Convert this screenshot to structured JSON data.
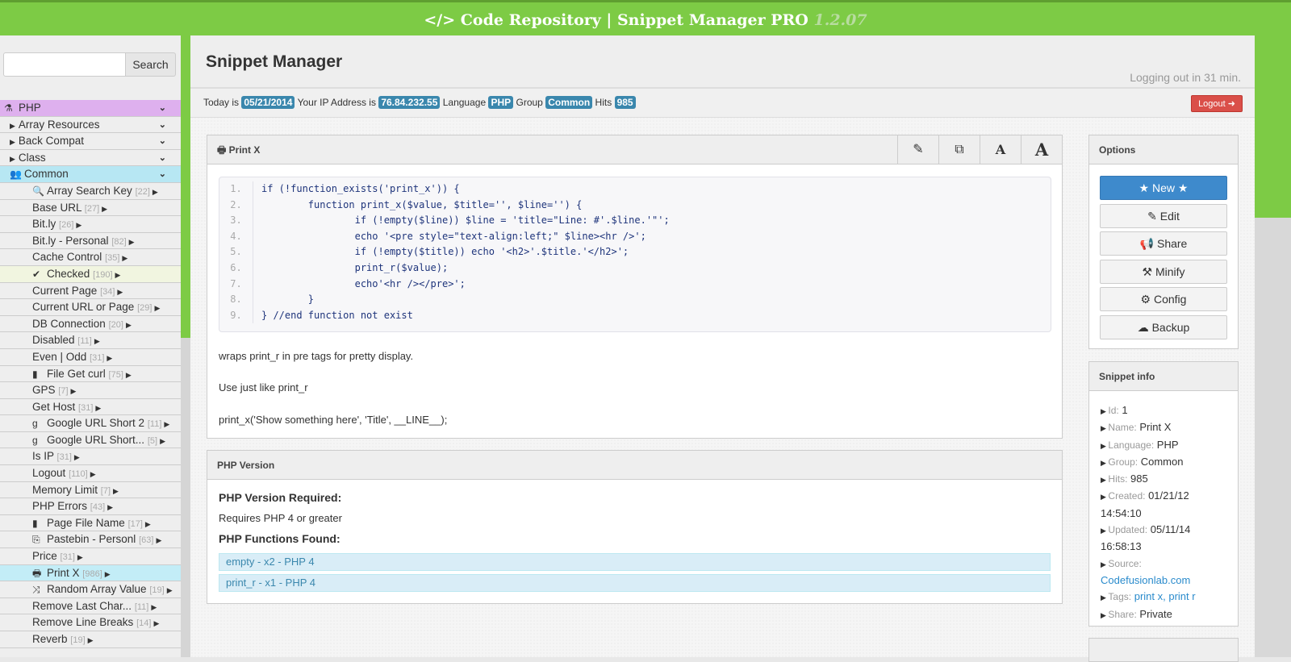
{
  "header": {
    "icon": "code-icon",
    "title": "Code Repository | Snippet Manager PRO",
    "version": "1.2.07"
  },
  "search": {
    "placeholder": "",
    "button": "Search"
  },
  "nav": [
    {
      "label": "PHP",
      "lvl": "lvl0",
      "icon": "⚗",
      "chev": true
    },
    {
      "label": "Array Resources",
      "lvl": "lvl1",
      "tri": true,
      "chev": true
    },
    {
      "label": "Back Compat",
      "lvl": "lvl1",
      "tri": true,
      "chev": true
    },
    {
      "label": "Class",
      "lvl": "lvl1",
      "tri": true,
      "chev": true
    },
    {
      "label": "Common",
      "lvl": "lvl1g",
      "icon": "👥",
      "chev": true
    },
    {
      "label": "Array Search Key",
      "count": "[22]",
      "lvl": "lvl2",
      "icon": "🔍"
    },
    {
      "label": "Base URL",
      "count": "[27]",
      "lvl": "lvl2"
    },
    {
      "label": "Bit.ly",
      "count": "[26]",
      "lvl": "lvl2"
    },
    {
      "label": "Bit.ly - Personal",
      "count": "[82]",
      "lvl": "lvl2"
    },
    {
      "label": "Cache Control",
      "count": "[35]",
      "lvl": "lvl2"
    },
    {
      "label": "Checked",
      "count": "[190]",
      "lvl": "lvl2",
      "icon": "✔",
      "bg": "#f1f5e0"
    },
    {
      "label": "Current Page",
      "count": "[34]",
      "lvl": "lvl2"
    },
    {
      "label": "Current URL or Page",
      "count": "[29]",
      "lvl": "lvl2"
    },
    {
      "label": "DB Connection",
      "count": "[20]",
      "lvl": "lvl2"
    },
    {
      "label": "Disabled",
      "count": "[11]",
      "lvl": "lvl2"
    },
    {
      "label": "Even | Odd",
      "count": "[31]",
      "lvl": "lvl2"
    },
    {
      "label": "File Get curl",
      "count": "[75]",
      "lvl": "lvl2",
      "icon": "▮"
    },
    {
      "label": "GPS",
      "count": "[7]",
      "lvl": "lvl2"
    },
    {
      "label": "Get Host",
      "count": "[31]",
      "lvl": "lvl2"
    },
    {
      "label": "Google URL Short 2",
      "count": "[11]",
      "lvl": "lvl2",
      "icon": "g"
    },
    {
      "label": "Google URL Short...",
      "count": "[5]",
      "lvl": "lvl2",
      "icon": "g"
    },
    {
      "label": "Is IP",
      "count": "[31]",
      "lvl": "lvl2"
    },
    {
      "label": "Logout",
      "count": "[110]",
      "lvl": "lvl2"
    },
    {
      "label": "Memory Limit",
      "count": "[7]",
      "lvl": "lvl2"
    },
    {
      "label": "PHP Errors",
      "count": "[43]",
      "lvl": "lvl2"
    },
    {
      "label": "Page File Name",
      "count": "[17]",
      "lvl": "lvl2",
      "icon": "▮"
    },
    {
      "label": "Pastebin - Personl",
      "count": "[63]",
      "lvl": "lvl2",
      "icon": "⎘"
    },
    {
      "label": "Price",
      "count": "[31]",
      "lvl": "lvl2"
    },
    {
      "label": "Print X",
      "count": "[986]",
      "lvl": "lvl2",
      "icon": "🖶",
      "bg": "#c3edf7"
    },
    {
      "label": "Random Array Value",
      "count": "[19]",
      "lvl": "lvl2",
      "icon": "⤨"
    },
    {
      "label": "Remove Last Char...",
      "count": "[11]",
      "lvl": "lvl2"
    },
    {
      "label": "Remove Line Breaks",
      "count": "[14]",
      "lvl": "lvl2"
    },
    {
      "label": "Reverb",
      "count": "[19]",
      "lvl": "lvl2"
    }
  ],
  "main": {
    "title": "Snippet Manager",
    "logout_notice": "Logging out in 31 min.",
    "info": {
      "today_label": "Today is",
      "date": "05/21/2014",
      "ip_label": "Your IP Address is",
      "ip": "76.84.232.55",
      "lang_label": "Language",
      "lang": "PHP",
      "group_label": "Group",
      "group": "Common",
      "hits_label": "Hits",
      "hits": "985"
    },
    "logout": "Logout"
  },
  "snippet": {
    "title": "Print X",
    "code": [
      "if (!function_exists('print_x')) {",
      "        function print_x($value, $title='', $line='') {",
      "                if (!empty($line)) $line = 'title=\"Line: #'.$line.'\"';",
      "                echo '<pre style=\"text-align:left;\" $line><hr />';",
      "                if (!empty($title)) echo '<h2>'.$title.'</h2>';",
      "                print_r($value);",
      "                echo'<hr /></pre>';",
      "        }",
      "} //end function not exist"
    ],
    "desc": [
      "wraps print_r in pre tags for pretty display.",
      "Use just like print_r",
      "print_x('Show something here', 'Title', __LINE__);"
    ]
  },
  "php_version": {
    "title": "PHP Version",
    "required_h": "PHP Version Required:",
    "required": "Requires PHP 4 or greater",
    "found_h": "PHP Functions Found:",
    "functions": [
      "empty - x2 - PHP 4",
      "print_r - x1 - PHP 4"
    ]
  },
  "options": {
    "title": "Options",
    "buttons": [
      "New",
      "Edit",
      "Share",
      "Minify",
      "Config",
      "Backup"
    ],
    "icons": [
      "★",
      "✎",
      "📢",
      "⚒",
      "⚙",
      "☁"
    ]
  },
  "info": {
    "title": "Snippet info",
    "rows": [
      {
        "k": "Id:",
        "v": "1"
      },
      {
        "k": "Name:",
        "v": "Print X"
      },
      {
        "k": "Language:",
        "v": "PHP"
      },
      {
        "k": "Group:",
        "v": "Common"
      },
      {
        "k": "Hits:",
        "v": "985"
      },
      {
        "k": "Created:",
        "v": "01/21/12 14:54:10"
      },
      {
        "k": "Updated:",
        "v": "05/11/14 16:58:13"
      },
      {
        "k": "Source:",
        "v": "Codefusionlab.com",
        "link": true
      },
      {
        "k": "Tags:",
        "v": "print x, print r",
        "link": true
      },
      {
        "k": "Share:",
        "v": "Private"
      }
    ]
  }
}
